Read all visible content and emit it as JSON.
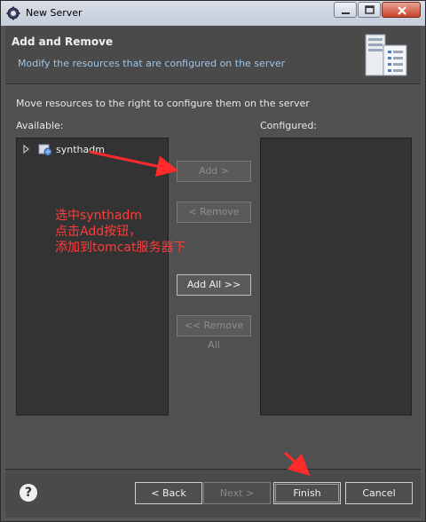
{
  "window": {
    "title": "New Server",
    "icon": "eclipse-gear-icon",
    "controls": [
      "minimize-icon",
      "maximize-icon",
      "close-icon"
    ]
  },
  "banner": {
    "title": "Add and Remove",
    "description": "Modify the resources that are configured on the server",
    "image": "server-icon"
  },
  "main": {
    "instruction": "Move resources to the right to configure them on the server",
    "available_label": "Available:",
    "configured_label": "Configured:",
    "available_items": [
      {
        "label": "synthadm",
        "icon": "web-project-icon",
        "expander": "expand-arrow-icon"
      }
    ],
    "configured_items": [],
    "buttons": {
      "add": "Add >",
      "remove": "< Remove",
      "add_all": "Add All >>",
      "remove_all": "<< Remove All"
    }
  },
  "annotation": {
    "line1": "选中synthadm",
    "line2": "点击Add按钮，",
    "line3": "添加到tomcat服务器下",
    "color": "#ff3b3b"
  },
  "footer": {
    "help_glyph": "?",
    "back": "< Back",
    "next": "Next >",
    "finish": "Finish",
    "cancel": "Cancel"
  }
}
